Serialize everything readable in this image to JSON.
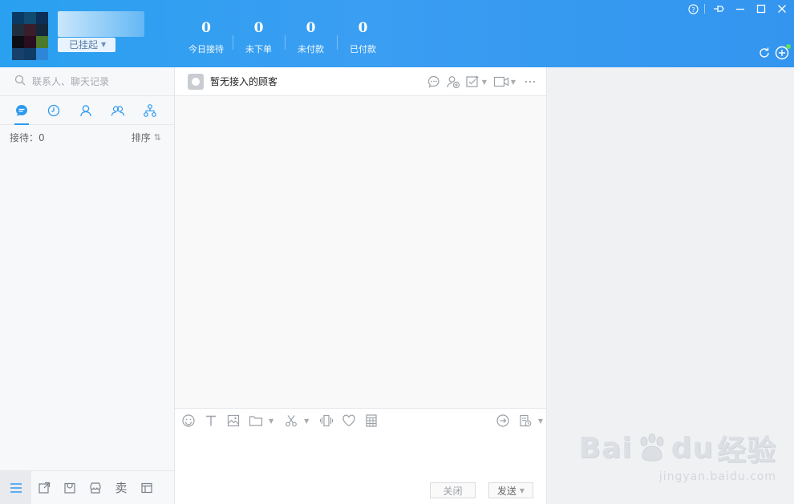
{
  "header": {
    "status_label": "已挂起",
    "stats": [
      {
        "value": "0",
        "label": "今日接待"
      },
      {
        "value": "0",
        "label": "未下单"
      },
      {
        "value": "0",
        "label": "未付款"
      },
      {
        "value": "0",
        "label": "已付款"
      }
    ],
    "accent_color": "#2d9af0"
  },
  "sidebar": {
    "search_placeholder": "联系人、聊天记录",
    "receiving_label": "接待：0",
    "sort_label": "排序",
    "sort_icon": "⇅",
    "bottom_sell_label": "卖"
  },
  "chat": {
    "title": "暂无接入的顾客",
    "close_label": "关闭",
    "send_label": "发送"
  },
  "watermark": {
    "main_prefix": "Bai",
    "main_suffix": "du",
    "main_cn": "经验",
    "sub": "jingyan.baidu.com"
  }
}
